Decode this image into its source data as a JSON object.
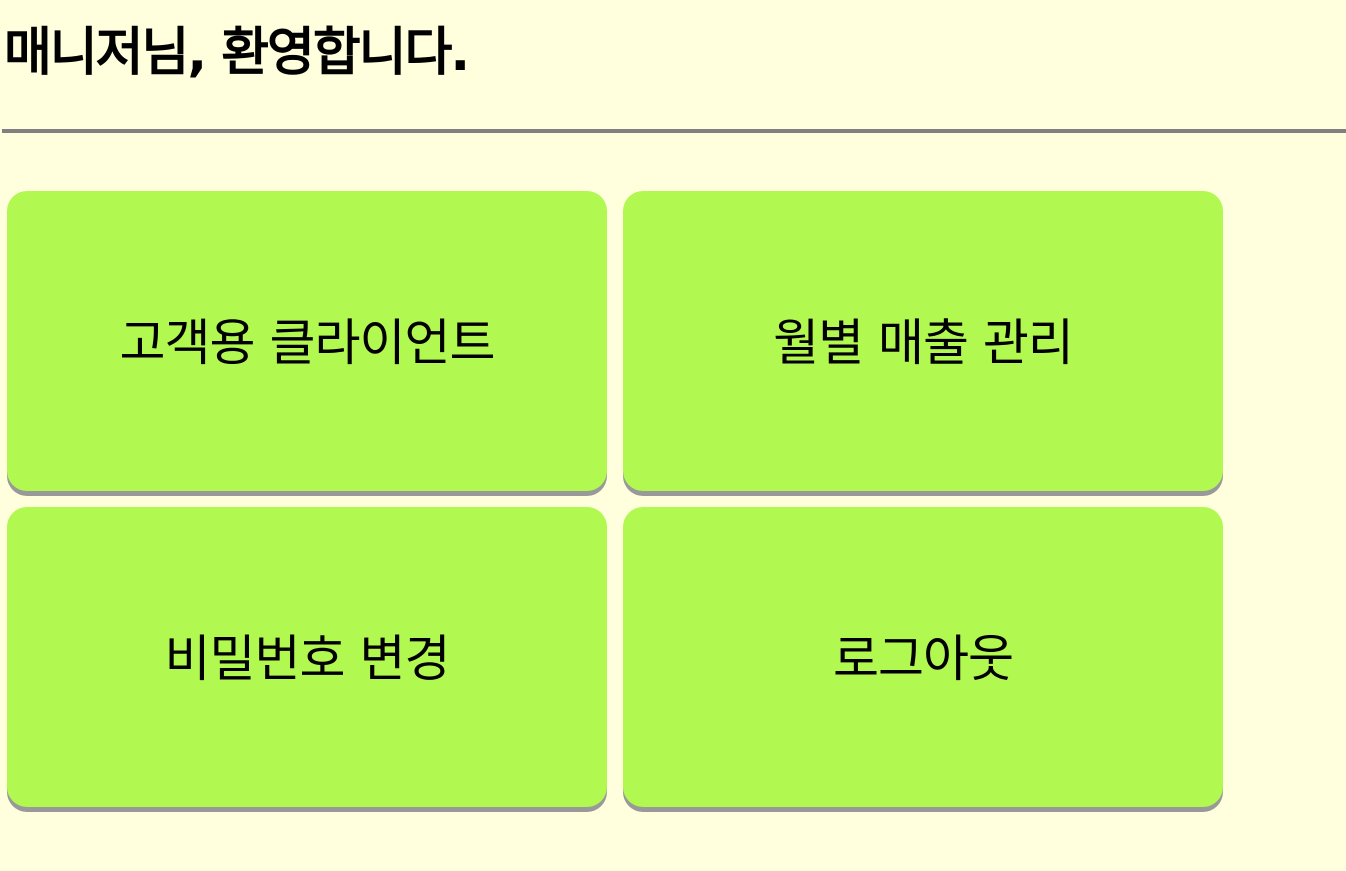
{
  "header": {
    "title": "매니저님, 환영합니다."
  },
  "menu": {
    "customer_client": "고객용 클라이언트",
    "monthly_sales": "월별 매출 관리",
    "change_password": "비밀번호 변경",
    "logout": "로그아웃"
  },
  "colors": {
    "background": "#ffffdd",
    "button": "#b1f850",
    "divider": "#808080"
  }
}
